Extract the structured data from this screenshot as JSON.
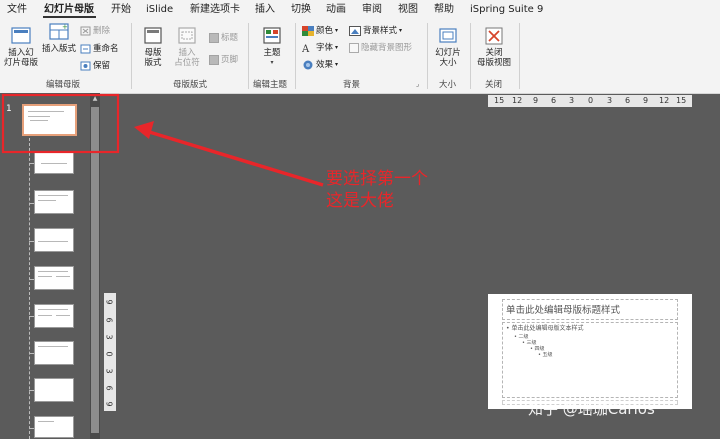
{
  "menu": {
    "items": [
      "文件",
      "幻灯片母版",
      "开始",
      "iSlide",
      "新建选项卡",
      "插入",
      "切换",
      "动画",
      "审阅",
      "视图",
      "帮助",
      "iSpring Suite 9"
    ],
    "active_index": 1
  },
  "ribbon": {
    "edit_master": {
      "insert_slide_master": "插入幻\n灯片母版",
      "insert_layout": "插入版式",
      "delete": "删除",
      "rename": "重命名",
      "preserve": "保留",
      "group_label": "编辑母版"
    },
    "master_layout": {
      "master_layout": "母版\n版式",
      "insert_placeholder": "插入\n占位符",
      "title": "标题",
      "footer": "页脚",
      "group_label": "母版版式"
    },
    "edit_theme": {
      "themes": "主题",
      "group_label": "编辑主题"
    },
    "background": {
      "colors": "颜色",
      "fonts": "字体",
      "effects": "效果",
      "background_styles": "背景样式",
      "hide_background_graphics": "隐藏背景图形",
      "group_label": "背景"
    },
    "size": {
      "slide_size": "幻灯片\n大小",
      "group_label": "大小"
    },
    "close": {
      "close_master_view": "关闭\n母版视图",
      "group_label": "关闭"
    }
  },
  "thumbnails": {
    "first_number": "1"
  },
  "h_ruler": [
    "15",
    "12",
    "9",
    "6",
    "3",
    "0",
    "3",
    "6",
    "9",
    "12",
    "15"
  ],
  "v_ruler": [
    "9",
    "6",
    "3",
    "0",
    "3",
    "6",
    "9"
  ],
  "master_slide": {
    "title": "单击此处编辑母版标题样式",
    "body_level1": "单击此处编辑母版文本样式",
    "body_level2": "二级",
    "body_level3": "三级",
    "body_level4": "四级",
    "body_level5": "五级"
  },
  "annotation": {
    "line1": "要选择第一个",
    "line2": "这是大佬",
    "color": "#e8262a"
  },
  "watermark": "知乎 @瑶珈Carlos"
}
